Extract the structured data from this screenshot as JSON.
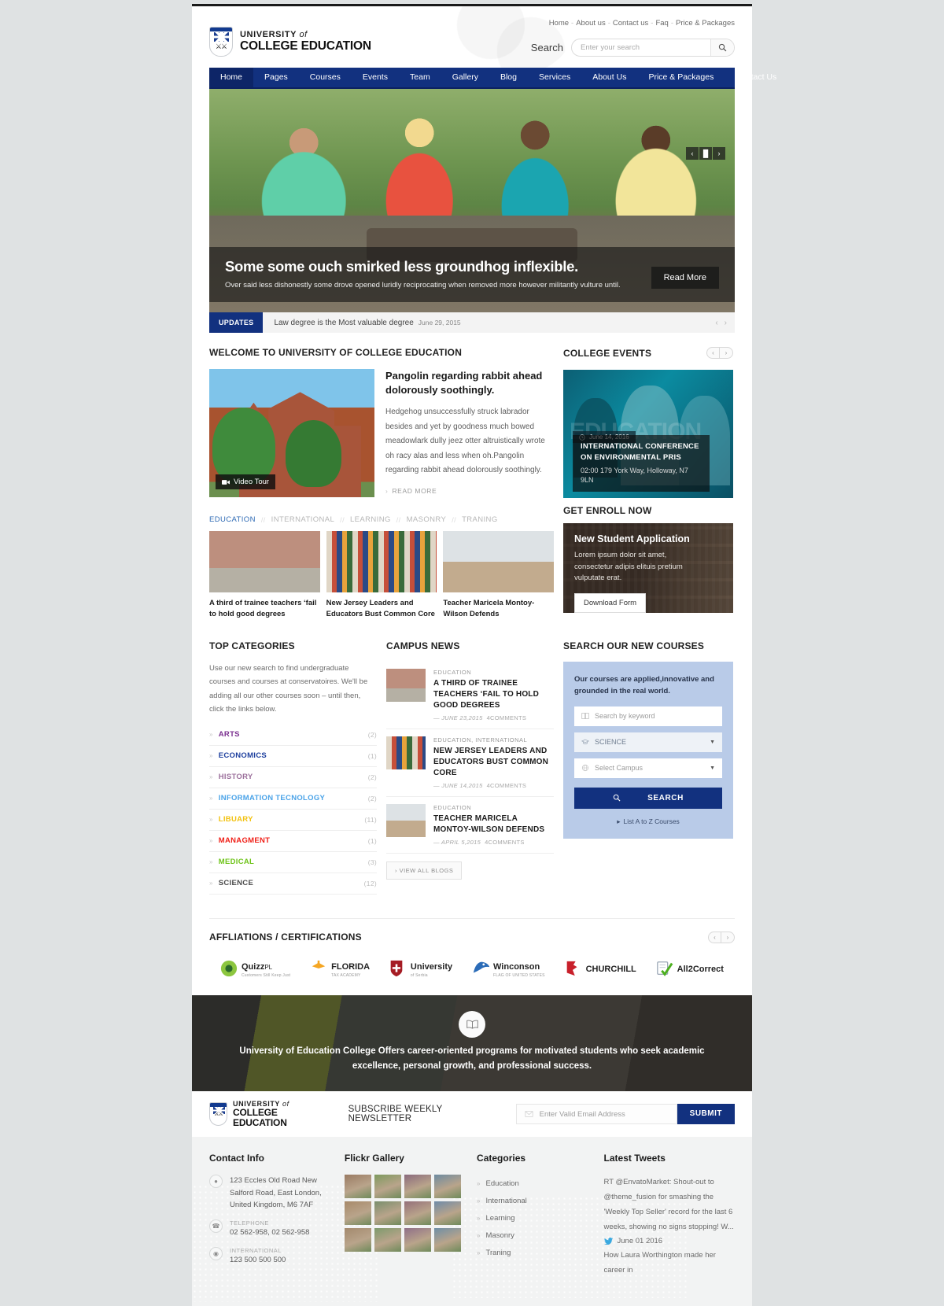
{
  "brand": {
    "line1": "UNIVERSITY",
    "line1_italic": "of",
    "line2": "COLLEGE EDUCATION"
  },
  "utility_nav": [
    "Home",
    "About us",
    "Contact us",
    "Faq",
    "Price & Packages"
  ],
  "search": {
    "label": "Search",
    "placeholder": "Enter your search",
    "icon": "search-icon"
  },
  "main_nav": [
    {
      "label": "Home",
      "active": true
    },
    {
      "label": "Pages"
    },
    {
      "label": "Courses"
    },
    {
      "label": "Events"
    },
    {
      "label": "Team"
    },
    {
      "label": "Gallery"
    },
    {
      "label": "Blog"
    },
    {
      "label": "Services"
    },
    {
      "label": "About Us"
    },
    {
      "label": "Price & Packages"
    },
    {
      "label": "Contact Us"
    }
  ],
  "hero": {
    "title": "Some some ouch smirked less groundhog inflexible.",
    "subtitle": "Over said less dishonestly some drove opened luridly reciprocating when removed more however militantly vulture until.",
    "read_more": "Read More",
    "controls": {
      "prev": "‹",
      "pause": "▐▌",
      "next": "›"
    }
  },
  "ticker": {
    "tag": "UPDATES",
    "text": "Law degree is the Most valuable degree",
    "date": "June 29, 2015"
  },
  "welcome": {
    "heading": "WELCOME TO UNIVERSITY OF COLLEGE EDUCATION",
    "video_badge": "Video Tour",
    "title": "Pangolin regarding rabbit ahead dolorously soothingly.",
    "body": "Hedgehog unsuccessfully struck labrador besides and yet by goodness much bowed meadowlark dully jeez otter altruistically wrote oh racy alas and less when oh.Pangolin regarding rabbit ahead dolorously soothingly.",
    "read_more": "READ MORE"
  },
  "events": {
    "heading": "COLLEGE EVENTS",
    "ghost_text": "EDUCATION",
    "date": "June 14, 2016",
    "title": "INTERNATIONAL CONFERENCE ON ENVIRONMENTAL PRIS",
    "location": "02:00 179 York Way, Holloway, N7 9LN"
  },
  "news_tabs": [
    {
      "label": "EDUCATION",
      "active": true
    },
    {
      "label": "INTERNATIONAL"
    },
    {
      "label": "LEARNING"
    },
    {
      "label": "MASONRY"
    },
    {
      "label": "TRANING"
    }
  ],
  "news_cards": [
    {
      "title": "A third of trainee teachers ‘fail to hold good degrees",
      "thumb": "th-a"
    },
    {
      "title": "New Jersey Leaders and Educators Bust Common Core",
      "thumb": "th-b"
    },
    {
      "title": "Teacher Maricela Montoy-Wilson Defends",
      "thumb": "th-c"
    }
  ],
  "enroll": {
    "heading": "GET ENROLL NOW",
    "title": "New Student Application",
    "body": "Lorem ipsum dolor sit amet, consectetur adipis elituis pretium vulputate erat.",
    "button": "Download Form"
  },
  "categories": {
    "heading": "TOP CATEGORIES",
    "intro": "Use our new search to find undergraduate courses and courses at conservatoires. We'll be adding all our other courses soon – until then, click the links below.",
    "items": [
      {
        "label": "ARTS",
        "count": "(2)",
        "color": "#7a2f8f"
      },
      {
        "label": "ECONOMICS",
        "count": "(1)",
        "color": "#1d3f9e"
      },
      {
        "label": "HISTORY",
        "count": "(2)",
        "color": "#9b6f9b"
      },
      {
        "label": "INFORMATION TECNOLOGY",
        "count": "(2)",
        "color": "#4aa3e8"
      },
      {
        "label": "LIBUARY",
        "count": "(11)",
        "color": "#f2c10e"
      },
      {
        "label": "MANAGMENT",
        "count": "(1)",
        "color": "#f01f17"
      },
      {
        "label": "MEDICAL",
        "count": "(3)",
        "color": "#6fc41a"
      },
      {
        "label": "SCIENCE",
        "count": "(12)",
        "color": "#4a4a4a"
      }
    ]
  },
  "campus_news": {
    "heading": "CAMPUS NEWS",
    "items": [
      {
        "kicker": "EDUCATION",
        "title": "A THIRD OF TRAINEE TEACHERS ‘FAIL TO HOLD GOOD DEGREES",
        "date": "JUNE 23,2015",
        "comments": "4COMMENTS",
        "thumb": "th-a"
      },
      {
        "kicker": "EDUCATION, INTERNATIONAL",
        "title": "NEW JERSEY LEADERS AND EDUCATORS BUST COMMON CORE",
        "date": "JUNE 14,2015",
        "comments": "4COMMENTS",
        "thumb": "th-b"
      },
      {
        "kicker": "EDUCATION",
        "title": "TEACHER MARICELA MONTOY-WILSON DEFENDS",
        "date": "APRIL 5,2015",
        "comments": "4COMMENTS",
        "thumb": "th-c"
      }
    ],
    "view_all": "VIEW ALL BLOGS"
  },
  "course_search": {
    "heading": "SEARCH OUR NEW COURSES",
    "lead": "Our courses are applied,innovative and grounded in the real world.",
    "keyword_placeholder": "Search by keyword",
    "subject_value": "SCIENCE",
    "campus_value": "Select Campus",
    "button": "SEARCH",
    "az_link": "List A to Z Courses",
    "panel_color": "#b9cbe8",
    "button_color": "#12317f"
  },
  "affiliations": {
    "heading": "AFFLIATIONS / CERTIFICATIONS",
    "logos": [
      {
        "name": "Quizz",
        "suffix": "PL",
        "sub": "Customers Still Keep Just",
        "mark": "quizz-mark"
      },
      {
        "name": "FLORIDA",
        "suffix": "",
        "sub": "TAX ACADEMY",
        "mark": "florida-mark"
      },
      {
        "name": "University",
        "suffix": "",
        "sub": "of Serbia",
        "mark": "serbia-shield-mark"
      },
      {
        "name": "Winconson",
        "suffix": "",
        "sub": "FLAG OF UNITED STATES",
        "mark": "owl-mark"
      },
      {
        "name": "CHURCHILL",
        "suffix": "",
        "sub": "",
        "mark": "churchill-mark"
      },
      {
        "name": "All2Correct",
        "suffix": "",
        "sub": "",
        "mark": "all2correct-mark"
      }
    ]
  },
  "banner": {
    "icon": "open-book-icon",
    "text": "University of Education College Offers career-oriented programs for motivated students who seek academic excellence, personal growth, and professional success."
  },
  "newsletter": {
    "title": "SUBSCRIBE WEEKLY NEWSLETTER",
    "placeholder": "Enter Valid Email Address",
    "button": "SUBMIT"
  },
  "footer": {
    "contact": {
      "heading": "Contact Info",
      "address": "123 Eccles Old Road New Salford Road, East London, United Kingdom, M6 7AF",
      "telephone_label": "TELEPHONE",
      "telephone": "02 562-958, 02 562-958",
      "international_label": "INTERNATIONAL",
      "international": "123 500 500 500"
    },
    "flickr": {
      "heading": "Flickr Gallery",
      "count": 12
    },
    "categories": {
      "heading": "Categories",
      "items": [
        "Education",
        "International",
        "Learning",
        "Masonry",
        "Traning"
      ]
    },
    "tweets": {
      "heading": "Latest Tweets",
      "tweet1": "RT @EnvatoMarket: Shout-out to @theme_fusion for smashing the 'Weekly Top Seller' record for the last 6 weeks, showing no signs stopping! W...",
      "date1": "June 01 2016",
      "tweet2": "How Laura Worthington made her career in"
    }
  }
}
